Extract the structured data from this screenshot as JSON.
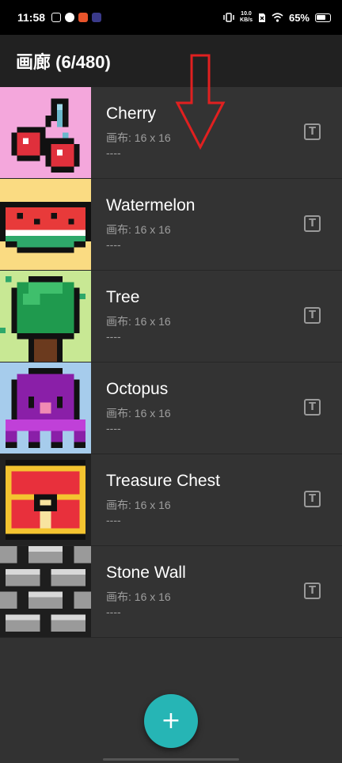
{
  "status": {
    "time": "11:58",
    "netspeed_value": "10.0",
    "netspeed_unit": "KB/s",
    "battery": "65%"
  },
  "app_bar": {
    "title": "画廊 (6/480)"
  },
  "items": [
    {
      "name": "Cherry",
      "canvas": "画布: 16 x 16",
      "desc": "----",
      "bg": "#f4a7dc"
    },
    {
      "name": "Watermelon",
      "canvas": "画布: 16 x 16",
      "desc": "----",
      "bg": "#fadb82"
    },
    {
      "name": "Tree",
      "canvas": "画布: 16 x 16",
      "desc": "----",
      "bg": "#c8e894"
    },
    {
      "name": "Octopus",
      "canvas": "画布: 16 x 16",
      "desc": "----",
      "bg": "#a6ccec"
    },
    {
      "name": "Treasure Chest",
      "canvas": "画布: 16 x 16",
      "desc": "----",
      "bg": "#222222"
    },
    {
      "name": "Stone Wall",
      "canvas": "画布: 16 x 16",
      "desc": "----",
      "bg": "#1e1e1e"
    }
  ],
  "fab": {
    "label": "+"
  },
  "colors": {
    "accent": "#26b5b5",
    "annotation_arrow": "#e02020"
  }
}
